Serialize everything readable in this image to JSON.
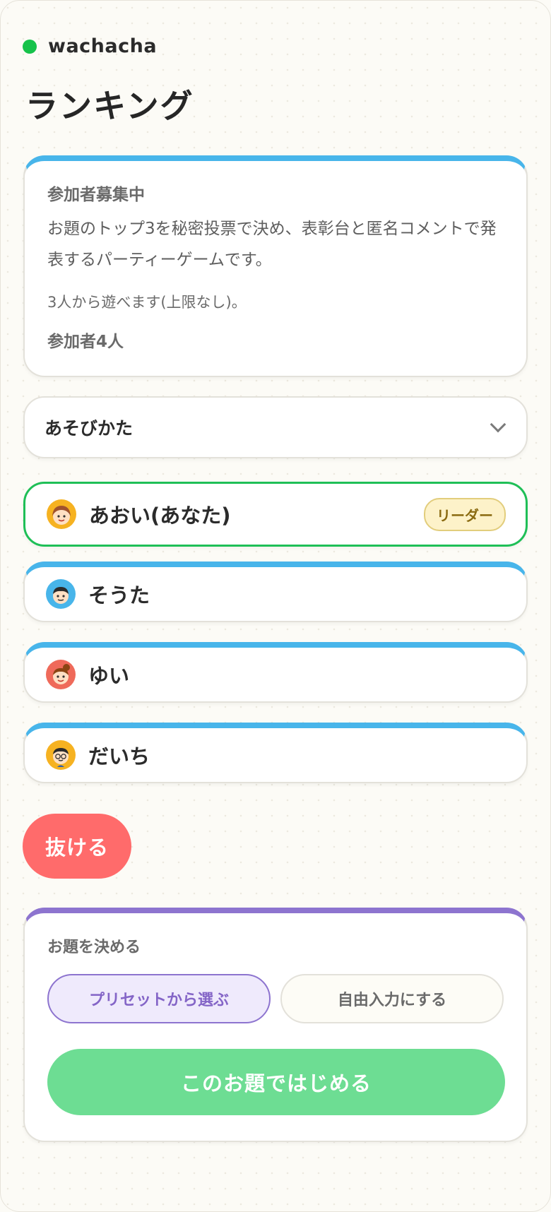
{
  "brand": {
    "name": "wachacha",
    "accent": "#16c24a"
  },
  "page": {
    "title": "ランキング"
  },
  "info": {
    "status": "参加者募集中",
    "description": "お題のトップ3を秘密投票で決め、表彰台と匿名コメントで発表するパーティーゲームです。",
    "limit": "3人から遊べます(上限なし)。",
    "count": "参加者4人"
  },
  "howto": {
    "label": "あそびかた",
    "icon": "chevron-down-icon"
  },
  "players": [
    {
      "name": "あおい(あなた)",
      "badge": "リーダー",
      "avatar": "girl-avatar",
      "avatar_color": "#f6b221"
    },
    {
      "name": "そうた",
      "avatar": "boy-avatar",
      "avatar_color": "#48b5ea"
    },
    {
      "name": "ゆい",
      "avatar": "girl-bun-avatar",
      "avatar_color": "#ef6a5a"
    },
    {
      "name": "だいち",
      "avatar": "boy-glasses-avatar",
      "avatar_color": "#f6b221"
    }
  ],
  "actions": {
    "leave_label": "抜ける"
  },
  "topic": {
    "heading": "お題を決める",
    "option_preset": "プリセットから選ぶ",
    "option_free": "自由入力にする",
    "start_label": "このお題ではじめる"
  },
  "colors": {
    "leave": "#ff6b6b",
    "start": "#6ddd93",
    "accent_blue": "#48b5ea",
    "accent_purple": "#8d74cf",
    "me_border": "#1fbf57"
  }
}
